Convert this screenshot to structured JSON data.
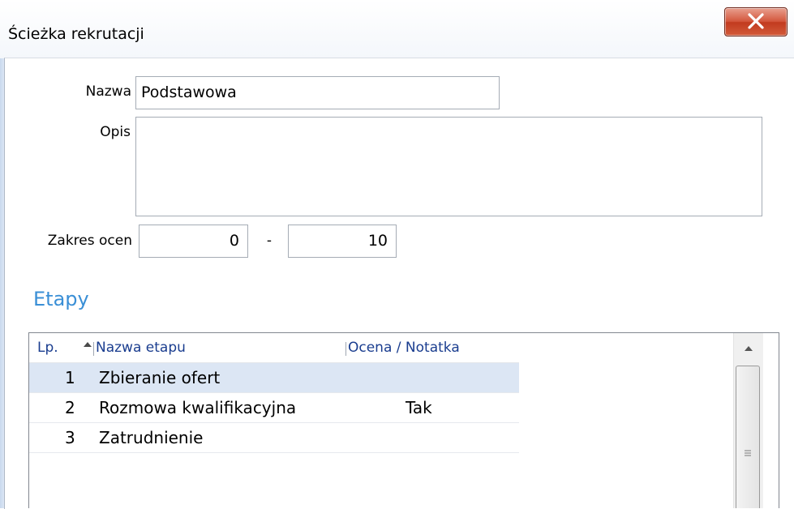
{
  "window": {
    "title": "Ścieżka rekrutacji",
    "close_glyph": "X"
  },
  "form": {
    "name_label": "Nazwa",
    "name_value": "Podstawowa",
    "desc_label": "Opis",
    "desc_value": "",
    "range_label": "Zakres ocen",
    "range_from": "0",
    "range_sep": "-",
    "range_to": "10"
  },
  "stages": {
    "title": "Etapy",
    "columns": [
      "Lp.",
      "Nazwa etapu",
      "Ocena / Notatka"
    ],
    "rows": [
      {
        "lp": "1",
        "name": "Zbieranie ofert",
        "note": ""
      },
      {
        "lp": "2",
        "name": "Rozmowa kwalifikacyjna",
        "note": "Tak"
      },
      {
        "lp": "3",
        "name": "Zatrudnienie",
        "note": ""
      }
    ]
  },
  "icons": {
    "close": "close-icon",
    "sort": "sort-ascending-icon",
    "scroll_up": "scroll-up-arrow-icon",
    "grip": "scroll-grip-icon"
  },
  "colors": {
    "section_title": "#3a8fd6",
    "header_text": "#1a3d8f",
    "selected_row": "#dce6f4",
    "close_button": "#c8442a"
  }
}
